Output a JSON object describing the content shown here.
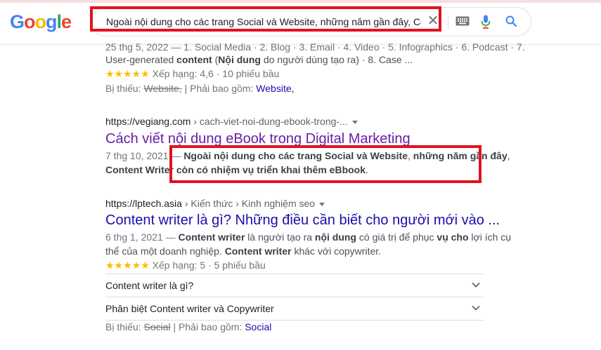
{
  "search": {
    "logo": "Google",
    "query": "Ngoài nội dung cho các trang Social và Website, những năm gần đây, Content Writer"
  },
  "result1": {
    "line_partial": "25 thg 5, 2022 — 1. Social Media · 2. Blog · 3. Email · 4. Video · 5. Infographics · 6. Podcast · 7.",
    "line2_pre": "User-generated ",
    "line2_b1": "content",
    "line2_mid": " (",
    "line2_b2": "Nội dung",
    "line2_post": " do người dùng tạo ra) · 8. Case ...",
    "stars": "★★★★★",
    "rating": "Xếp hạng: 4,6 · 10 phiếu bầu",
    "missing_label": "Bị thiếu:",
    "missing_term": "Website,",
    "must_include_label": "| Phải bao gồm:",
    "must_include_term": "Website,"
  },
  "result2": {
    "url": "https://vegiang.com",
    "breadcrumb": "› cach-viet-noi-dung-ebook-trong-...",
    "title": "Cách viết nội dung eBook trong Digital Marketing",
    "date": "7 thg 10, 2021 — ",
    "snippet_b1": "Ngoài nội dung cho các trang Social và Website",
    "snippet_mid1": ", ",
    "snippet_b2": "những năm gần đây",
    "snippet_mid2": ",",
    "snippet_b3": "Content Writer",
    "snippet_mid3": " ",
    "snippet_b4": "còn có nhiệm vụ triển khai thêm eBbook",
    "snippet_end": "."
  },
  "result3": {
    "url": "https://lptech.asia",
    "breadcrumb": "› Kiến thức › Kinh nghiệm seo",
    "title": "Content writer là gì? Những điều cần biết cho người mới vào ...",
    "date": "6 thg 1, 2021 — ",
    "s_b1": "Content writer",
    "s_t1": " là người tạo ra ",
    "s_b2": "nội dung",
    "s_t2": " có giá trị để phục ",
    "s_b3": "vụ cho",
    "s_t3": " lợi ích cụ",
    "s_line2_pre": "thể của một doanh nghiệp. ",
    "s_b4": "Content writer",
    "s_line2_post": " khác với copywriter.",
    "stars": "★★★★★",
    "rating": "Xếp hạng: 5 · 5 phiếu bầu",
    "faq": [
      "Content writer là gì?",
      "Phân biệt Content writer và Copywriter"
    ],
    "missing_label": "Bị thiếu:",
    "missing_term": "Social",
    "must_include_label": "| Phải bao gồm:",
    "must_include_term": "Social"
  },
  "colors": {
    "highlight": "#e0131f",
    "link": "#1a0dab",
    "visited": "#681da8",
    "star": "#fbbc04"
  }
}
